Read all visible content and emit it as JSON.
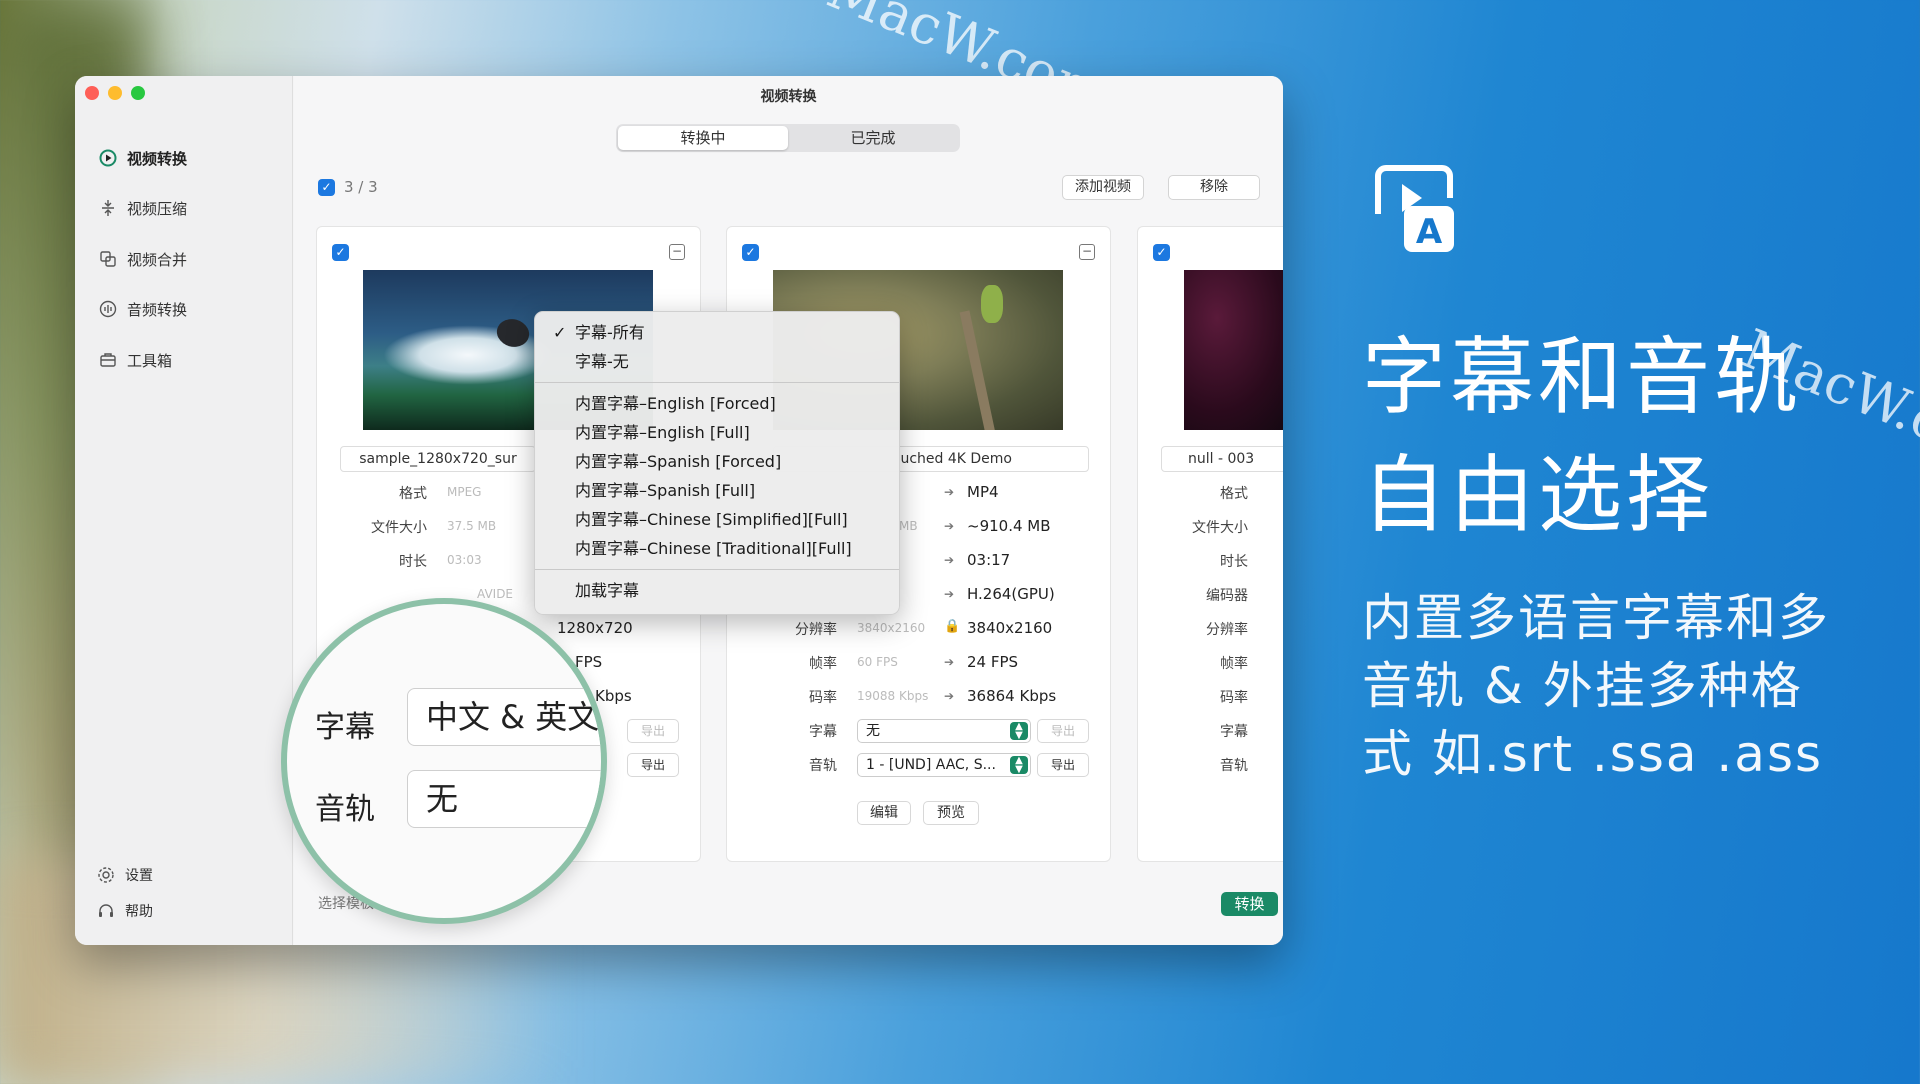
{
  "window": {
    "title": "视频转换",
    "segment": {
      "active": "转换中",
      "inactive": "已完成"
    },
    "select_count": "3 / 3",
    "add_video": "添加视频",
    "remove": "移除",
    "convert": "转换",
    "template_label": "选择模板"
  },
  "sidebar": {
    "items": [
      {
        "label": "视频转换",
        "icon": "play-circle-icon"
      },
      {
        "label": "视频压缩",
        "icon": "compress-icon"
      },
      {
        "label": "视频合并",
        "icon": "merge-icon"
      },
      {
        "label": "音频转换",
        "icon": "audio-wave-icon"
      },
      {
        "label": "工具箱",
        "icon": "toolbox-icon"
      }
    ],
    "settings": "设置",
    "help": "帮助"
  },
  "labels": {
    "format": "格式",
    "size": "文件大小",
    "duration": "时长",
    "codec": "编码器",
    "resolution": "分辨率",
    "fps": "帧率",
    "bitrate": "码率",
    "subtitle": "字幕",
    "audio": "音轨"
  },
  "card1": {
    "filename": "sample_1280x720_sur",
    "format_old": "MPEG",
    "size_old": "37.5 MB",
    "duration_old": "03:03",
    "codec_old": "AVIDE",
    "resolution_new": "1280x720",
    "fps_new": "FPS",
    "bitrate_new": "Kbps",
    "export": "导出",
    "export2": "导出"
  },
  "card2": {
    "filename": "uched 4K Demo",
    "size_old": "MB",
    "format_new": "MP4",
    "size_new": "~910.4 MB",
    "duration_new": "03:17",
    "codec_new": "H.264(GPU)",
    "resolution_old": "3840x2160",
    "resolution_new": "3840x2160",
    "fps_old": "60 FPS",
    "fps_new": "24 FPS",
    "bitrate_old": "19088 Kbps",
    "bitrate_new": "36864 Kbps",
    "subtitle_value": "无",
    "audio_value": "1 - [UND] AAC, S...",
    "export": "导出",
    "export2": "导出",
    "edit": "编辑",
    "preview": "预览"
  },
  "card3": {
    "filename": "null - 003"
  },
  "menu": {
    "checkmark": "✓",
    "group1": [
      "字幕-所有",
      "字幕-无"
    ],
    "group2": [
      "内置字幕–English [Forced]",
      "内置字幕–English [Full]",
      "内置字幕–Spanish [Forced]",
      "内置字幕–Spanish [Full]",
      "内置字幕–Chinese [Simplified][Full]",
      "内置字幕–Chinese [Traditional][Full]"
    ],
    "load": "加载字幕"
  },
  "magnifier": {
    "subtitle_label": "字幕",
    "subtitle_value": "中文 & 英文",
    "audio_label": "音轨",
    "audio_value": "无"
  },
  "promo": {
    "line1": "字幕和音轨",
    "line2": "自由选择",
    "sub1": "内置多语言字幕和多",
    "sub2": "音轨 & 外挂多种格",
    "sub3": "式 如.srt .ssa .ass",
    "icon_letter": "A"
  },
  "watermark": "MacW.com",
  "colors": {
    "accent": "#1c78e0",
    "convert_green": "#1a8a66",
    "promo_bg": "#1678cc"
  }
}
